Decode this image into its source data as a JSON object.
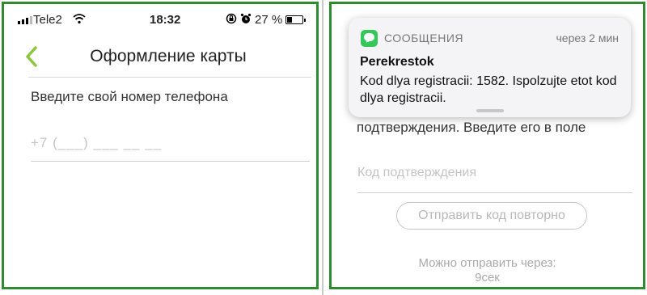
{
  "left": {
    "status_bar": {
      "carrier": "Tele2",
      "time": "18:32",
      "battery": "27 %",
      "signal_icon": "signal-bars-icon",
      "wifi_icon": "wifi-icon",
      "lock_icon": "rotation-lock-icon",
      "alarm_icon": "alarm-icon",
      "battery_icon": "battery-icon"
    },
    "nav": {
      "back_icon": "chevron-left-icon",
      "title": "Оформление карты"
    },
    "prompt": "Введите свой номер телефона",
    "phone_placeholder": "+7 (___) ___ __ __"
  },
  "right": {
    "notification": {
      "app_icon": "messages-icon",
      "app": "СООБЩЕНИЯ",
      "time": "через 2 мин",
      "sender": "Perekrestok",
      "body": "Kod dlya registracii: 1582. Ispolzujte etot kod dlya registracii."
    },
    "behind_text": "подтверждения. Введите его в поле",
    "code_placeholder": "Код подтверждения",
    "resend_label": "Отправить код повторно",
    "timer_label": "Можно отправить через:",
    "timer_value": "9сек"
  },
  "colors": {
    "accent_green": "#8cc63f",
    "frame_green": "#2e8b2e",
    "messages_green": "#34c759"
  }
}
